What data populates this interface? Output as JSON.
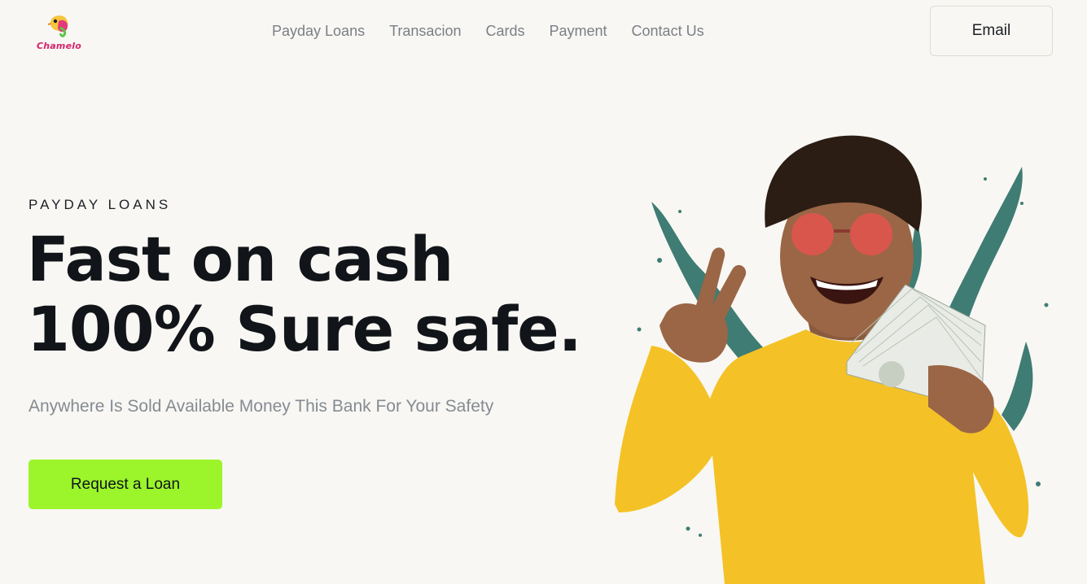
{
  "brand": {
    "logo_text": "Chamelo"
  },
  "nav": {
    "items": [
      {
        "label": "Payday Loans"
      },
      {
        "label": "Transacion"
      },
      {
        "label": "Cards"
      },
      {
        "label": "Payment"
      },
      {
        "label": "Contact Us"
      }
    ]
  },
  "header": {
    "email_label": "Email"
  },
  "hero": {
    "eyebrow": "PAYDAY LOANS",
    "headline_line1": "Fast on cash",
    "headline_line2": "100% Sure safe.",
    "subtitle": "Anywhere Is Sold Available Money This Bank For Your Safety",
    "cta_label": "Request a Loan"
  },
  "colors": {
    "background": "#f8f7f3",
    "accent": "#9cf52b",
    "headline": "#111419",
    "muted": "#858b92",
    "splash": "#3f7c73",
    "sweater": "#f4c226"
  },
  "icons": {
    "logo": "chameleon-logo-icon"
  }
}
